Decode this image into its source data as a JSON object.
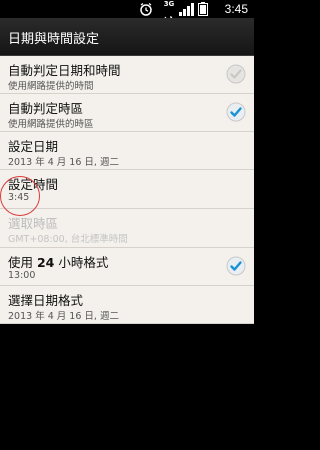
{
  "status_bar": {
    "time": "3:45",
    "network": "3G",
    "icons": [
      "alarm-icon",
      "network-3g-icon",
      "signal-icon",
      "battery-icon"
    ]
  },
  "header": {
    "title": "日期與時間設定"
  },
  "settings": [
    {
      "title": "自動判定日期和時間",
      "subtitle": "使用網路提供的時間",
      "checked": false,
      "enabled": true
    },
    {
      "title": "自動判定時區",
      "subtitle": "使用網路提供的時區",
      "checked": true,
      "enabled": true
    },
    {
      "title": "設定日期",
      "subtitle": "2013 年 4 月 16 日, 週二",
      "enabled": true
    },
    {
      "title": "設定時間",
      "subtitle": "3:45",
      "enabled": true
    },
    {
      "title": "選取時區",
      "subtitle": "GMT+08:00, 台北標準時間",
      "enabled": false
    },
    {
      "title_prefix": "使用 ",
      "title_bold": "24",
      "title_suffix": " 小時格式",
      "subtitle": "13:00",
      "checked": true,
      "enabled": true
    },
    {
      "title": "選擇日期格式",
      "subtitle": "2013 年 4 月 16 日, 週二",
      "enabled": true
    }
  ],
  "colors": {
    "check_blue": "#1a93d4",
    "check_grey": "#c8c8c8",
    "annotation_red": "#d83a3a"
  }
}
